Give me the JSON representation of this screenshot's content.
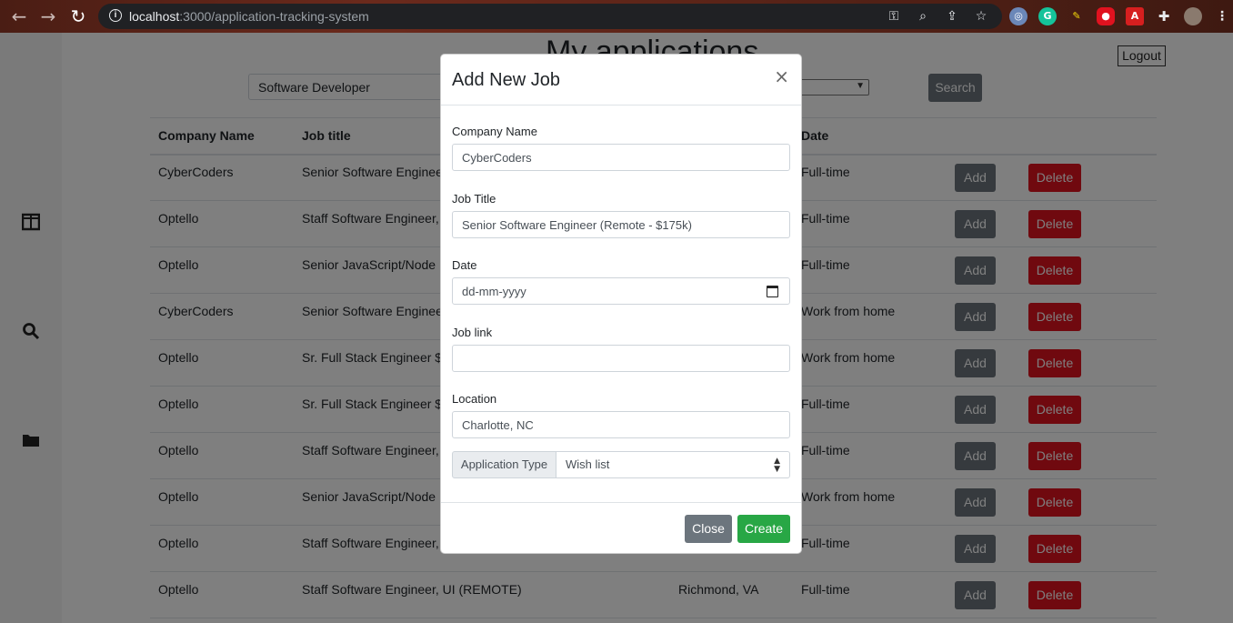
{
  "browser": {
    "url_host": "localhost",
    "url_path": ":3000/application-tracking-system"
  },
  "page": {
    "title": "My applications",
    "logout_label": "Logout",
    "search_value": "Software Developer",
    "search_button": "Search"
  },
  "table": {
    "headers": [
      "Company Name",
      "Job title",
      "",
      "Date",
      "",
      ""
    ],
    "rows": [
      {
        "company": "CyberCoders",
        "title": "Senior Software Engineer (Remote - $175k)",
        "location": "",
        "type": "Full-time"
      },
      {
        "company": "Optello",
        "title": "Staff Software Engineer, UI (REMOTE)",
        "location": "",
        "type": "Full-time"
      },
      {
        "company": "Optello",
        "title": "Senior JavaScript/Node Developer",
        "location": "",
        "type": "Full-time"
      },
      {
        "company": "CyberCoders",
        "title": "Senior Software Engineer (Remote - $175k)",
        "location": "",
        "type": "Work from home"
      },
      {
        "company": "Optello",
        "title": "Sr. Full Stack Engineer $175k",
        "location": "",
        "type": "Work from home"
      },
      {
        "company": "Optello",
        "title": "Sr. Full Stack Engineer $175k",
        "location": "",
        "type": "Full-time"
      },
      {
        "company": "Optello",
        "title": "Staff Software Engineer, UI (REMOTE)",
        "location": "",
        "type": "Full-time"
      },
      {
        "company": "Optello",
        "title": "Senior JavaScript/Node Developer",
        "location": "",
        "type": "Work from home"
      },
      {
        "company": "Optello",
        "title": "Staff Software Engineer, UI (REMOTE)",
        "location": "",
        "type": "Full-time"
      },
      {
        "company": "Optello",
        "title": "Staff Software Engineer, UI (REMOTE)",
        "location": "Richmond, VA",
        "type": "Full-time"
      }
    ],
    "add_label": "Add",
    "delete_label": "Delete"
  },
  "modal": {
    "title": "Add New Job",
    "close_x": "×",
    "company_label": "Company Name",
    "company_value": "CyberCoders",
    "job_title_label": "Job Title",
    "job_title_value": "Senior Software Engineer (Remote - $175k)",
    "date_label": "Date",
    "date_placeholder": "dd-mm-yyyy",
    "job_link_label": "Job link",
    "job_link_value": "",
    "location_label": "Location",
    "location_value": "Charlotte, NC",
    "app_type_label": "Application Type",
    "app_type_value": "Wish list",
    "close_button": "Close",
    "create_button": "Create"
  },
  "colors": {
    "delete": "#e0121f",
    "add": "#6c757d",
    "create": "#28a745"
  }
}
